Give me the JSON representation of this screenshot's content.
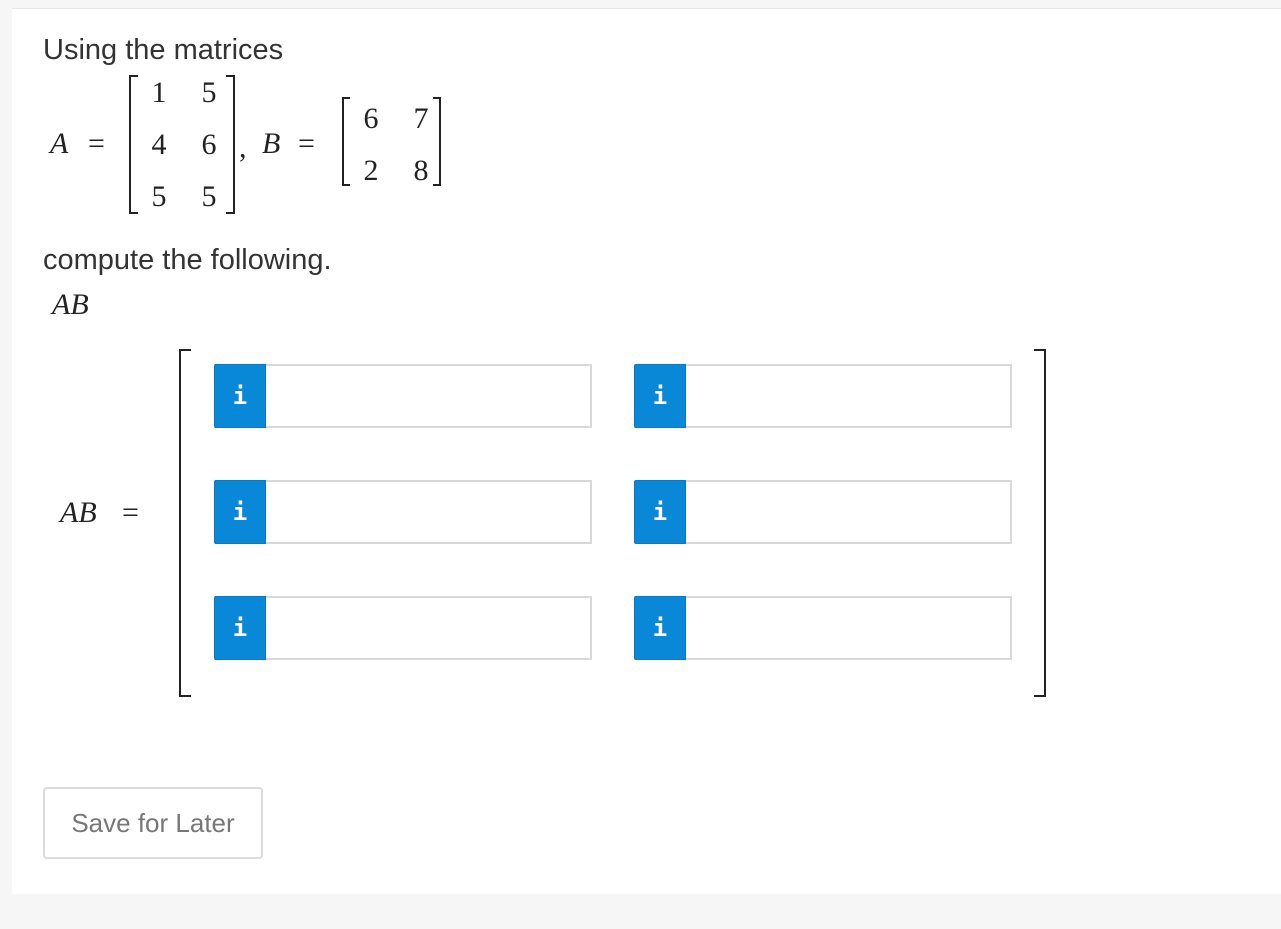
{
  "question": {
    "intro": "Using the matrices",
    "instruction": "compute the following.",
    "target_expression": "AB"
  },
  "matrix_A": {
    "name": "A",
    "equals": "=",
    "rows": [
      [
        "1",
        "5"
      ],
      [
        "4",
        "6"
      ],
      [
        "5",
        "5"
      ]
    ]
  },
  "separator": ",",
  "matrix_B": {
    "name": "B",
    "equals": "=",
    "rows": [
      [
        "6",
        "7"
      ],
      [
        "2",
        "8"
      ]
    ]
  },
  "answer": {
    "label": "AB",
    "equals": "=",
    "info_icon": "i",
    "cells": [
      [
        {
          "value": "",
          "placeholder": ""
        },
        {
          "value": "",
          "placeholder": ""
        }
      ],
      [
        {
          "value": "",
          "placeholder": ""
        },
        {
          "value": "",
          "placeholder": ""
        }
      ],
      [
        {
          "value": "",
          "placeholder": ""
        },
        {
          "value": "",
          "placeholder": ""
        }
      ]
    ]
  },
  "actions": {
    "save_label": "Save for Later"
  },
  "colors": {
    "info_button": "#0a88d8",
    "page_background": "#f6f6f6",
    "card_background": "#ffffff"
  }
}
